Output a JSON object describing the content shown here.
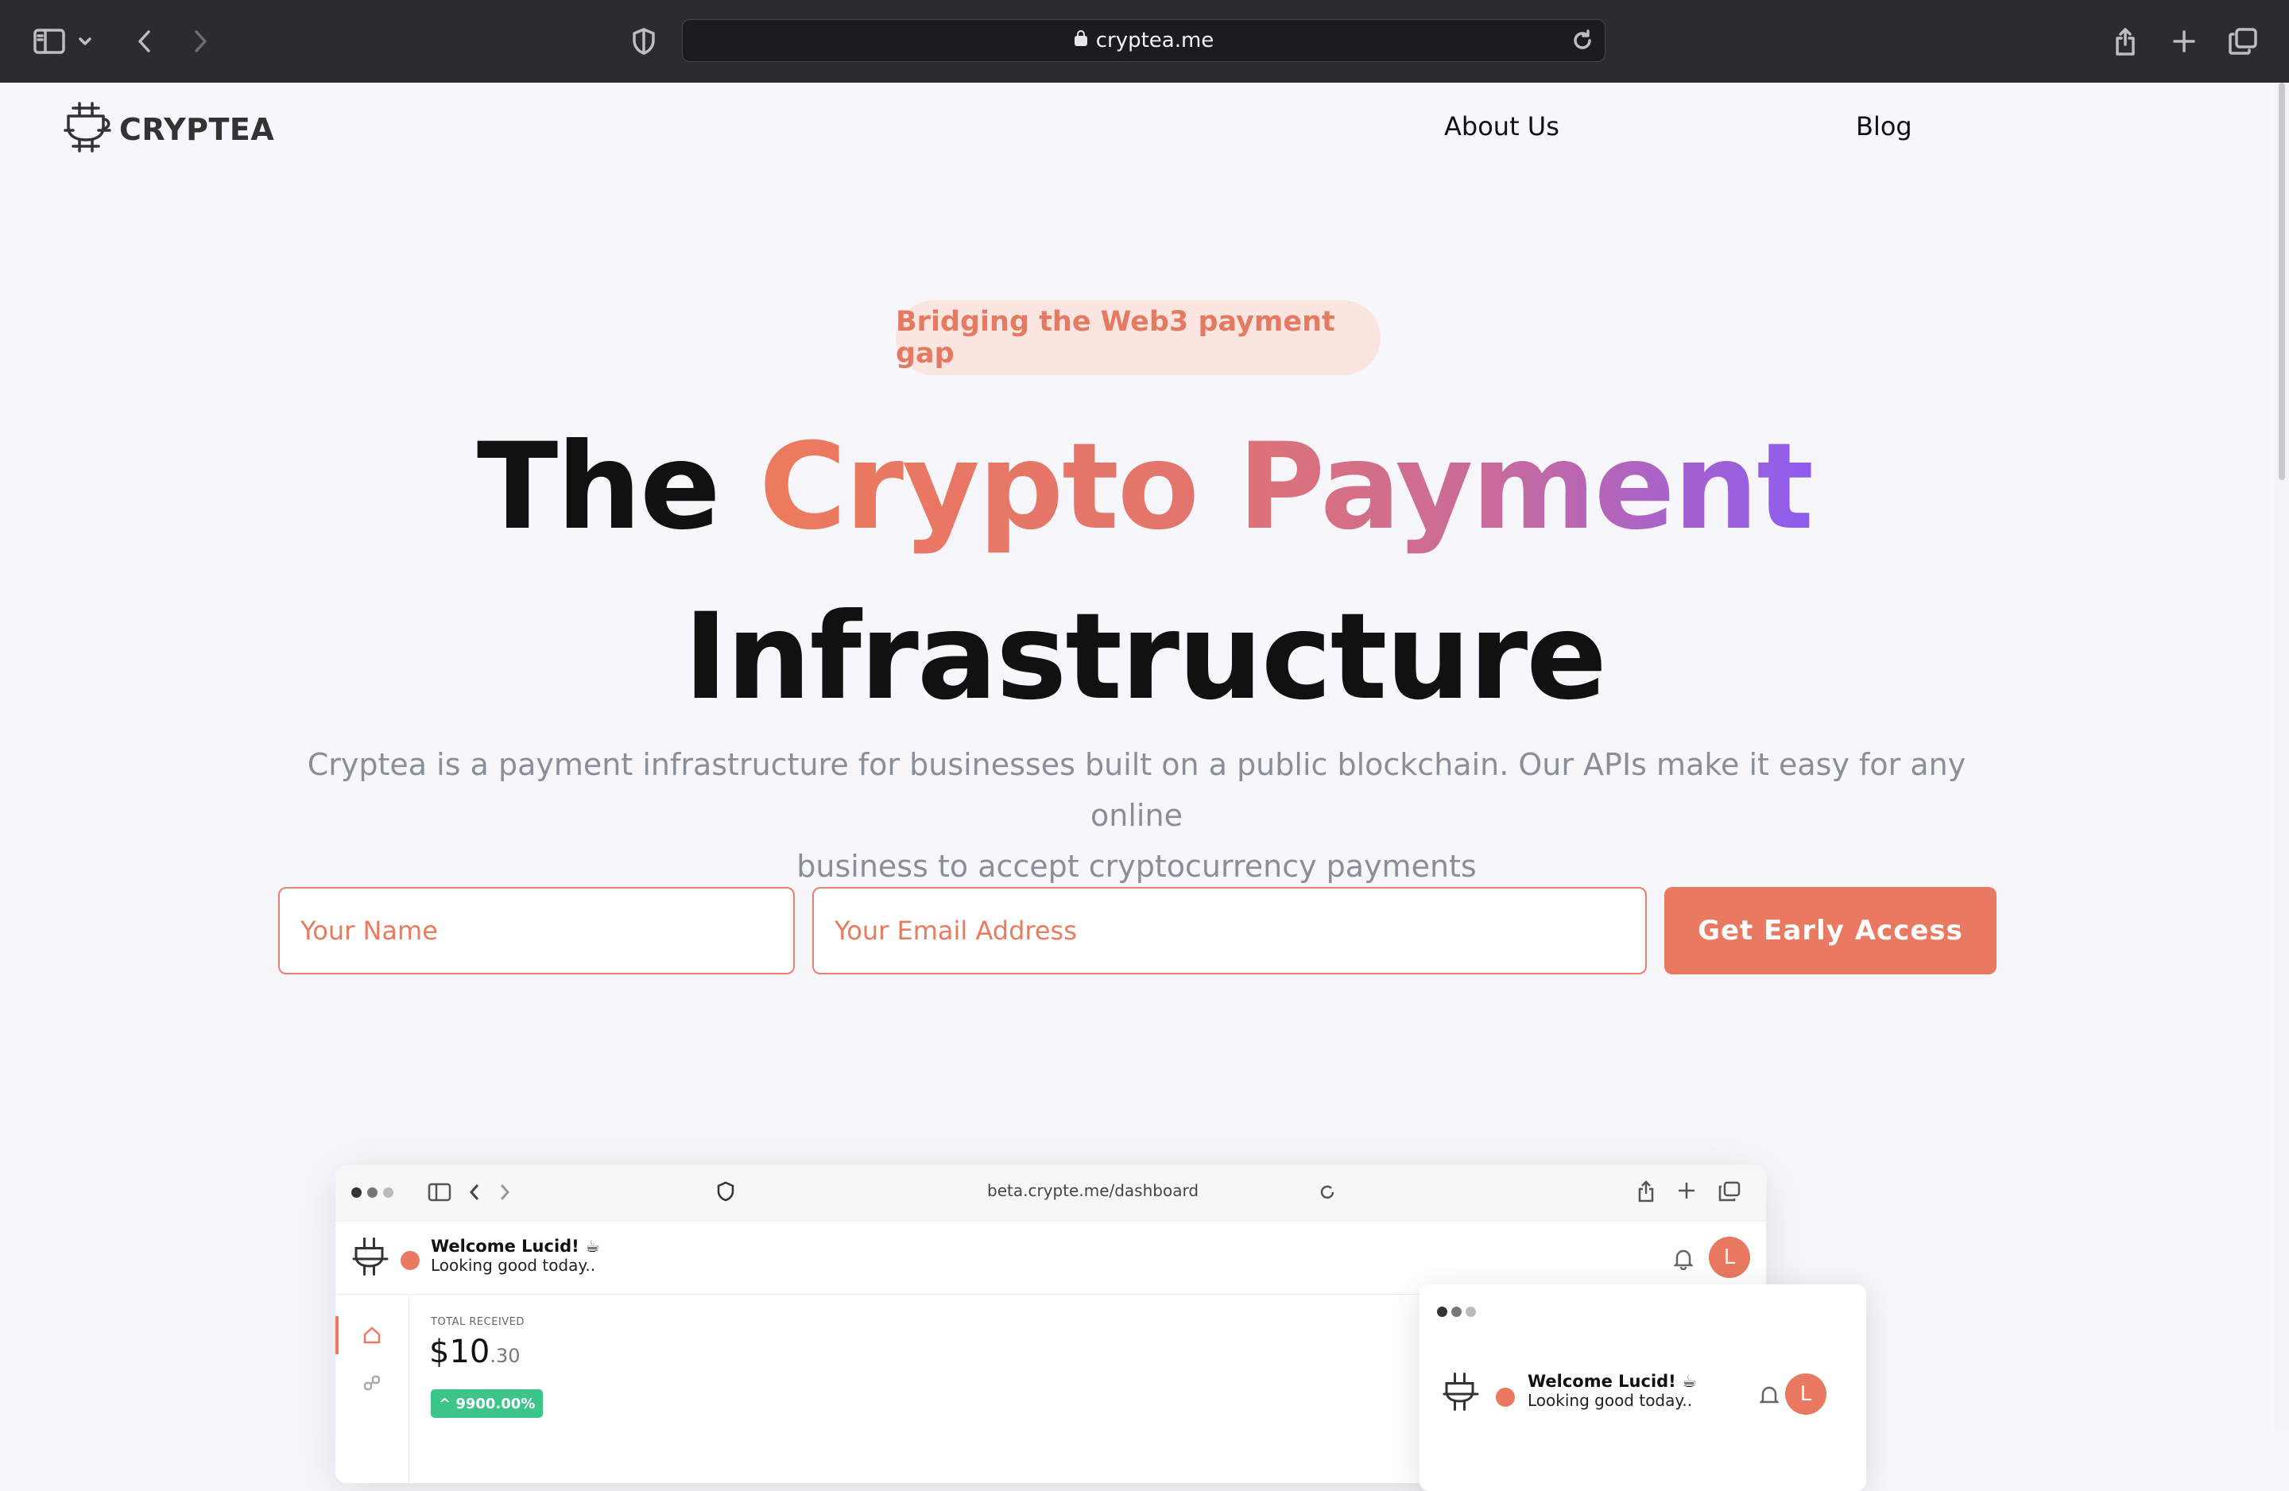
{
  "browser": {
    "url": "cryptea.me",
    "icons": [
      "sidebar-icon",
      "chevron-down-icon",
      "back-icon",
      "forward-icon",
      "shield-icon",
      "lock-icon",
      "reload-icon",
      "share-icon",
      "plus-icon",
      "tabs-icon"
    ]
  },
  "site": {
    "logo_text": "CRYPTEA",
    "nav": {
      "about": "About Us",
      "blog": "Blog"
    }
  },
  "hero": {
    "pill": "Bridging the Web3 payment gap",
    "title_plain": "The ",
    "title_gradient": "Crypto Payment",
    "title_line2": "Infrastructure",
    "subtitle_line1": "Cryptea is a payment infrastructure for businesses built on a public blockchain. Our APIs make it easy for any online",
    "subtitle_line2": "business to accept cryptocurrency payments",
    "name_placeholder": "Your Name",
    "email_placeholder": "Your Email Address",
    "cta": "Get Early Access"
  },
  "preview": {
    "url": "beta.crypte.me/dashboard",
    "welcome": "Welcome Lucid! ☕",
    "looking": "Looking good today..",
    "avatar_letter": "L",
    "total_label": "TOTAL RECEIVED",
    "amount_main": "$10",
    "amount_cents": ".30",
    "badge": "^ 9900.00%"
  },
  "colors": {
    "accent": "#e97a61",
    "pill_bg": "#fbe5e1",
    "gradient_start": "#ec7a5d",
    "gradient_end": "#8d5cf0",
    "subtitle": "#8a8e98",
    "badge_green": "#3cc48a"
  }
}
